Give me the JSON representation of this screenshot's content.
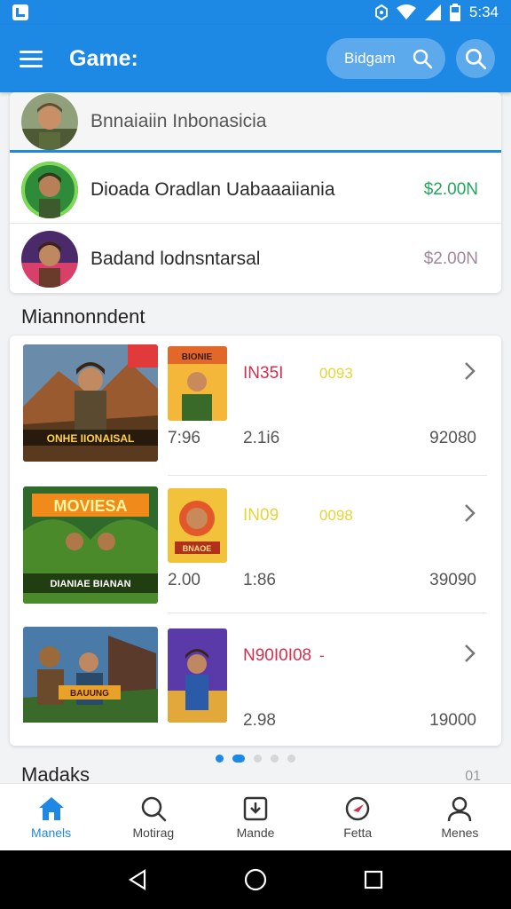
{
  "status_bar": {
    "time": "5:34"
  },
  "app_bar": {
    "title": "Game:",
    "search_placeholder": "Bidgam"
  },
  "accounts": [
    {
      "name": "Bnnaiaiin Inbonasicia",
      "price": ""
    },
    {
      "name": "Dioada Oradlan Uabaaaiiania",
      "price": "$2.00N",
      "price_color": "#22a45d"
    },
    {
      "name": "Badand lodnsntarsal",
      "price": "$2.00N",
      "price_color": "#a08898"
    }
  ],
  "section_title": "Miannonndent",
  "games": [
    {
      "banner_text": "ONHE IIONAISAL",
      "thumb_text": "BIONIE",
      "code": "IN35I",
      "code_color": "#d32f4f",
      "tag": "0093",
      "tag_color": "#e8d43a",
      "v1": "7:96",
      "v2": "2.1i6",
      "v3": "92080"
    },
    {
      "banner_text": "MOVIESA",
      "banner_text2": "DIANIAE BIANAN",
      "thumb_text": "BNAOE",
      "code": "IN09",
      "code_color": "#e8d43a",
      "tag": "0098",
      "tag_color": "#e8d43a",
      "v1": "2.00",
      "v2": "1:86",
      "v3": "39090"
    },
    {
      "banner_text": "BAUUNG",
      "thumb_text": "",
      "code": "N90I0I08",
      "code_color": "#d32f4f",
      "tag": "-",
      "tag_color": "#d32f4f",
      "v1": "",
      "v2": "2.98",
      "v3": "19000"
    }
  ],
  "pager": {
    "count": 5,
    "active": 1
  },
  "next_section_title": "Madaks",
  "next_section_count": "01",
  "bottom_nav": [
    {
      "label": "Manels",
      "icon": "home-icon",
      "active": true
    },
    {
      "label": "Motirag",
      "icon": "search-icon",
      "active": false
    },
    {
      "label": "Mande",
      "icon": "download-icon",
      "active": false
    },
    {
      "label": "Fetta",
      "icon": "compass-icon",
      "active": false
    },
    {
      "label": "Menes",
      "icon": "person-icon",
      "active": false
    }
  ],
  "colors": {
    "primary": "#1e88e5",
    "price_green": "#22a45d",
    "price_muted": "#a08898",
    "code_red": "#d32f4f",
    "code_yellow": "#e8d43a"
  }
}
